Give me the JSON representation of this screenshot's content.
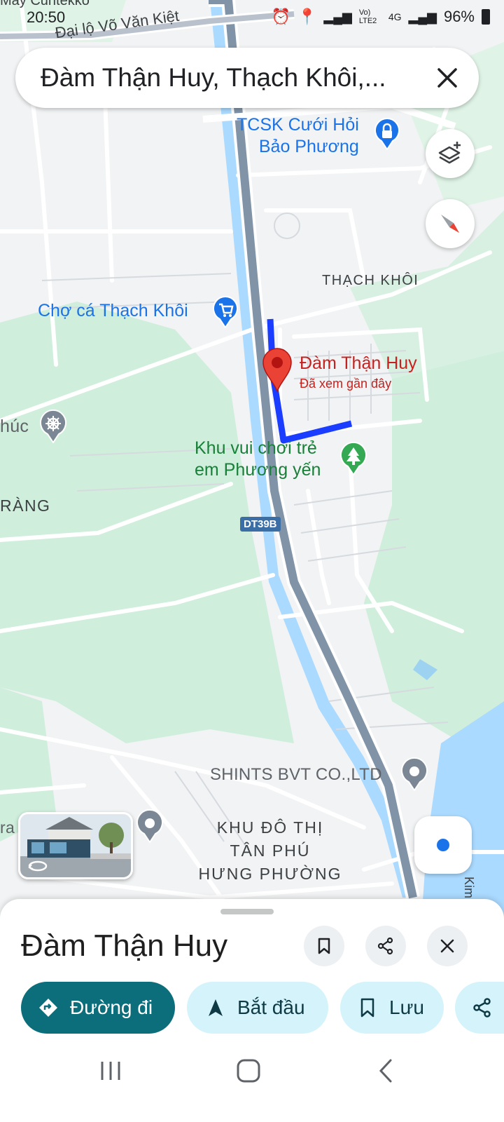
{
  "status_bar": {
    "time": "20:50",
    "battery": "96%",
    "network": "4G",
    "volte": "Vo) LTE2",
    "notification_text": "Máy Cuntekko"
  },
  "search": {
    "query": "Đàm Thận Huy, Thạch Khôi,..."
  },
  "map": {
    "labels": {
      "road_top": "Đại lộ Võ Văn Kiệt",
      "poi_wedding": "TCSK Cưới Hỏi Bảo Phương",
      "poi_wedding_l1": "TCSK Cưới Hỏi",
      "poi_wedding_l2": "Bảo Phương",
      "area_thach_khoi": "THẠCH KHÔI",
      "poi_market": "Chợ cá Thạch Khôi",
      "pin_name": "Đàm Thận Huy",
      "pin_sub": "Đã xem gần đây",
      "poi_left": "húc",
      "poi_park_l1": "Khu vui chơi trẻ",
      "poi_park_l2": "em Phương yến",
      "area_left": "RÀNG",
      "route_shield": "DT39B",
      "poi_company": "SHINTS BVT CO.,LTD",
      "poi_left_bottom": "ra",
      "area_bottom_l1": "KHU ĐÔ THỊ",
      "area_bottom_l2": "TÂN PHÚ",
      "area_bottom_l3": "HƯNG PHƯỜNG",
      "edge_right": "Kim"
    },
    "colors": {
      "route": "#1a3dff",
      "pin": "#d93025",
      "green_poi": "#188038",
      "blue_poi": "#1a73e8",
      "highway": "#7d8fa3",
      "water": "#aadaff",
      "park": "#c8ebd4"
    }
  },
  "sheet": {
    "title": "Đàm Thận Huy",
    "actions": {
      "directions": "Đường đi",
      "start": "Bắt đầu",
      "save": "Lưu"
    }
  }
}
